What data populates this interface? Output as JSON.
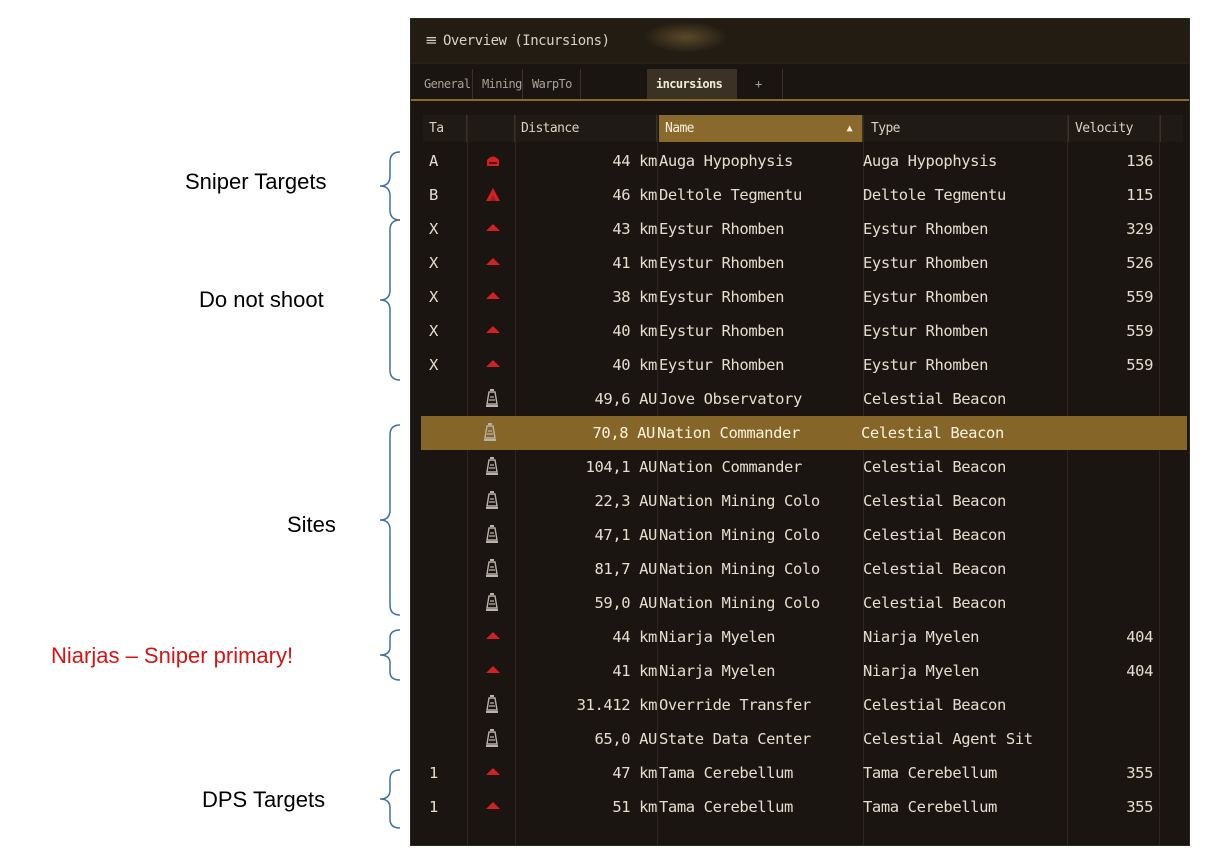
{
  "annotations": {
    "sniper_targets": "Sniper Targets",
    "do_not_shoot": "Do not shoot",
    "sites": "Sites",
    "niarjas": "Niarjas – Sniper primary!",
    "dps_targets": "DPS Targets"
  },
  "window": {
    "title": "Overview (Incursions)",
    "menu_icon": "≡",
    "tabs": [
      {
        "label": "General",
        "active": false
      },
      {
        "label": "Mining",
        "active": false
      },
      {
        "label": "WarpTo",
        "active": false
      },
      {
        "label": "incursions",
        "active": true
      },
      {
        "label": "+",
        "active": false
      }
    ]
  },
  "table": {
    "columns": [
      {
        "label": "Ta",
        "sorted": false
      },
      {
        "label": "",
        "sorted": false
      },
      {
        "label": "Distance",
        "sorted": false
      },
      {
        "label": "Name",
        "sorted": true,
        "sort_dir": "▲"
      },
      {
        "label": "Type",
        "sorted": false
      },
      {
        "label": "Velocity",
        "sorted": false
      }
    ],
    "rows": [
      {
        "tag": "A",
        "icon": "red-ship-icon-large",
        "distance": "44 km",
        "name": "Auga Hypophysis",
        "type": "Auga Hypophysis",
        "velocity": "136",
        "selected": false
      },
      {
        "tag": "B",
        "icon": "red-ship-icon-chevron",
        "distance": "46 km",
        "name": "Deltole Tegmentu",
        "type": "Deltole Tegmentu",
        "velocity": "115",
        "selected": false
      },
      {
        "tag": "X",
        "icon": "red-ship-icon",
        "distance": "43 km",
        "name": "Eystur Rhomben",
        "type": "Eystur Rhomben",
        "velocity": "329",
        "selected": false
      },
      {
        "tag": "X",
        "icon": "red-ship-icon",
        "distance": "41 km",
        "name": "Eystur Rhomben",
        "type": "Eystur Rhomben",
        "velocity": "526",
        "selected": false
      },
      {
        "tag": "X",
        "icon": "red-ship-icon",
        "distance": "38 km",
        "name": "Eystur Rhomben",
        "type": "Eystur Rhomben",
        "velocity": "559",
        "selected": false
      },
      {
        "tag": "X",
        "icon": "red-ship-icon",
        "distance": "40 km",
        "name": "Eystur Rhomben",
        "type": "Eystur Rhomben",
        "velocity": "559",
        "selected": false
      },
      {
        "tag": "X",
        "icon": "red-ship-icon",
        "distance": "40 km",
        "name": "Eystur Rhomben",
        "type": "Eystur Rhomben",
        "velocity": "559",
        "selected": false
      },
      {
        "tag": "",
        "icon": "beacon-icon",
        "distance": "49,6 AU",
        "name": "Jove Observatory",
        "type": "Celestial Beacon",
        "velocity": "",
        "selected": false
      },
      {
        "tag": "",
        "icon": "beacon-icon",
        "distance": "70,8 AU",
        "name": "Nation Commander",
        "type": "Celestial Beacon",
        "velocity": "",
        "selected": true
      },
      {
        "tag": "",
        "icon": "beacon-icon",
        "distance": "104,1 AU",
        "name": "Nation Commander",
        "type": "Celestial Beacon",
        "velocity": "",
        "selected": false
      },
      {
        "tag": "",
        "icon": "beacon-icon",
        "distance": "22,3 AU",
        "name": "Nation Mining Colo",
        "type": "Celestial Beacon",
        "velocity": "",
        "selected": false
      },
      {
        "tag": "",
        "icon": "beacon-icon",
        "distance": "47,1 AU",
        "name": "Nation Mining Colo",
        "type": "Celestial Beacon",
        "velocity": "",
        "selected": false
      },
      {
        "tag": "",
        "icon": "beacon-icon",
        "distance": "81,7 AU",
        "name": "Nation Mining Colo",
        "type": "Celestial Beacon",
        "velocity": "",
        "selected": false
      },
      {
        "tag": "",
        "icon": "beacon-icon",
        "distance": "59,0 AU",
        "name": "Nation Mining Colo",
        "type": "Celestial Beacon",
        "velocity": "",
        "selected": false
      },
      {
        "tag": "",
        "icon": "red-ship-icon",
        "distance": "44 km",
        "name": "Niarja Myelen",
        "type": "Niarja Myelen",
        "velocity": "404",
        "selected": false
      },
      {
        "tag": "",
        "icon": "red-ship-icon",
        "distance": "41 km",
        "name": "Niarja Myelen",
        "type": "Niarja Myelen",
        "velocity": "404",
        "selected": false
      },
      {
        "tag": "",
        "icon": "beacon-icon",
        "distance": "31.412 km",
        "name": "Override Transfer",
        "type": "Celestial Beacon",
        "velocity": "",
        "selected": false
      },
      {
        "tag": "",
        "icon": "beacon-icon",
        "distance": "65,0 AU",
        "name": "State Data Center",
        "type": "Celestial Agent Sit",
        "velocity": "",
        "selected": false
      },
      {
        "tag": "1",
        "icon": "red-ship-icon",
        "distance": "47 km",
        "name": "Tama Cerebellum",
        "type": "Tama Cerebellum",
        "velocity": "355",
        "selected": false
      },
      {
        "tag": "1",
        "icon": "red-ship-icon",
        "distance": "51 km",
        "name": "Tama Cerebellum",
        "type": "Tama Cerebellum",
        "velocity": "355",
        "selected": false
      }
    ]
  },
  "colors": {
    "hostile_red": "#d42020",
    "beacon_gray": "#b8b2a8",
    "selection_gold": "#856528",
    "annotation_red": "#d81313",
    "brace_blue": "#41719c"
  }
}
